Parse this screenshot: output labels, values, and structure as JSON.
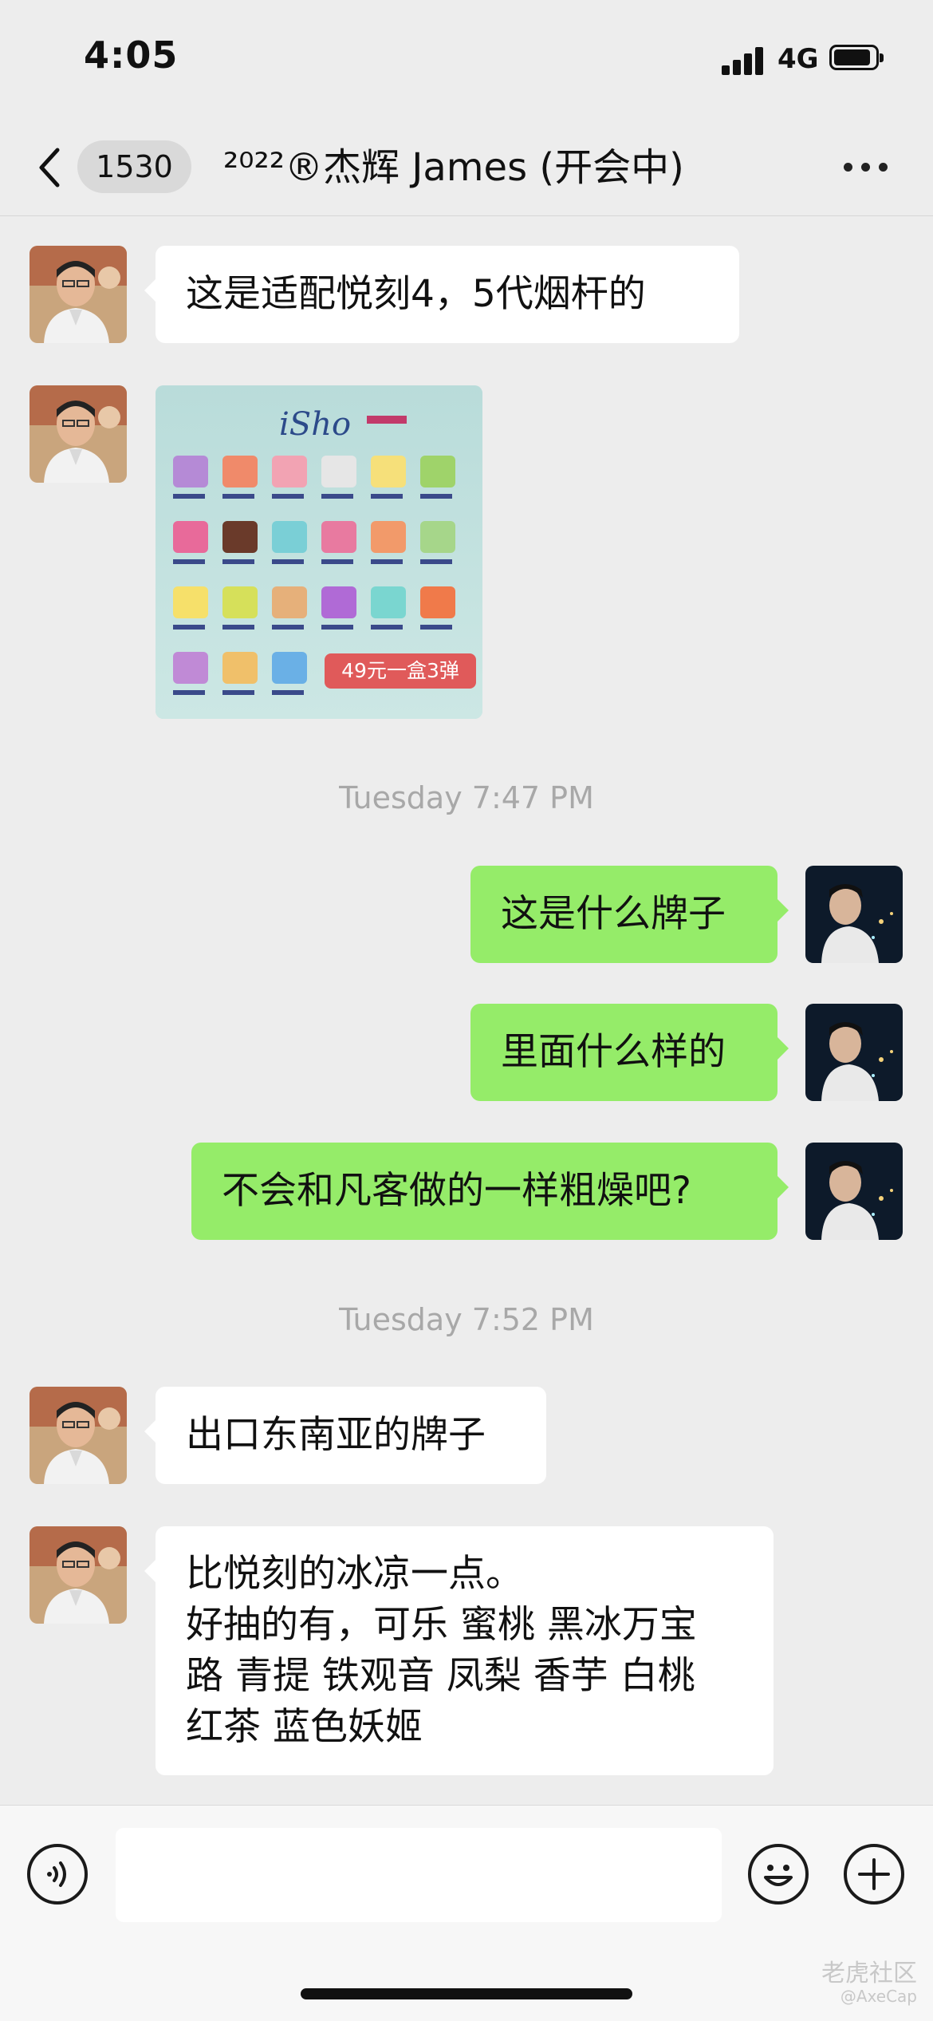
{
  "status_bar": {
    "time": "4:05",
    "network": "4G"
  },
  "nav": {
    "back_count": "1530",
    "title": "²⁰²²®杰辉 James (开会中)"
  },
  "messages": [
    {
      "text": "这是适配悦刻4，5代烟杆的"
    },
    {
      "image_price_tag": "49元一盒3弹",
      "image_brand": "iSho"
    },
    {
      "text": "这是什么牌子"
    },
    {
      "text": "里面什么样的"
    },
    {
      "text": "不会和凡客做的一样粗燥吧?"
    },
    {
      "text": "出口东南亚的牌子"
    },
    {
      "text": "比悦刻的冰凉一点。\n好抽的有，可乐 蜜桃 黑冰万宝\n路 青提 铁观音  凤梨 香芋 白桃\n红茶 蓝色妖姬"
    }
  ],
  "timestamps": [
    "Tuesday 7:47 PM",
    "Tuesday 7:52 PM"
  ],
  "icons": {
    "back": "chevron-left-icon",
    "more": "more-dots-icon",
    "voice": "voice-icon",
    "emoji": "emoji-icon",
    "plus": "plus-icon",
    "apple": "apple-logo-icon"
  },
  "watermark": {
    "name": "老虎社区",
    "handle": "@AxeCap"
  },
  "colors": {
    "outgoing_bubble": "#95ec69",
    "incoming_bubble": "#ffffff",
    "background": "#ededed"
  }
}
